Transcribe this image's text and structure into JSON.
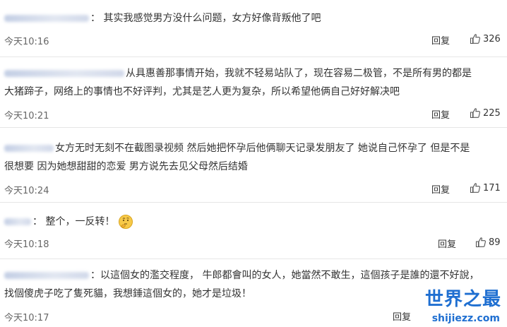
{
  "comments": [
    {
      "text_lines": [
        "： 其实我感觉男方没什么问题，女方好像背叛他了吧"
      ],
      "time": "今天10:16",
      "reply": "回复",
      "likes": "326"
    },
    {
      "text_lines": [
        "从具惠善那事情开始，我就不轻易站队了，现在容易二极管，不是所有男的都是",
        "大猪蹄子，网络上的事情也不好评判，尤其是艺人更为复杂，所以希望他俩自己好好解决吧"
      ],
      "time": "今天10:21",
      "reply": "回复",
      "likes": "225"
    },
    {
      "text_lines": [
        "女方无时无刻不在截图录视频 然后她把怀孕后他俩聊天记录发朋友了 她说自己怀孕了 但是不是",
        "很想要 因为她想甜甜的恋爱 男方说先去见父母然后结婚"
      ],
      "time": "今天10:24",
      "reply": "回复",
      "likes": "171"
    },
    {
      "text_lines": [
        "： 整个，一反转！"
      ],
      "time": "今天10:18",
      "reply": "回复",
      "likes": "89"
    },
    {
      "text_lines": [
        "：以這個女的濫交程度， 牛郎都會叫的女人，她當然不敢生，這個孩子是誰的還不好說，",
        "找個傻虎子吃了隻死貓，我想錘這個女的，她才是垃圾！"
      ],
      "time": "今天10:17",
      "reply": "回复"
    }
  ],
  "watermark": {
    "title": "世界之最",
    "url": "shijiezz.com"
  },
  "icons": {
    "like": "thumbs-up-icon",
    "emoji": "thinking-face-emoji"
  },
  "colors": {
    "watermark": "#1f6fd1",
    "divider": "#e6e6e6"
  }
}
